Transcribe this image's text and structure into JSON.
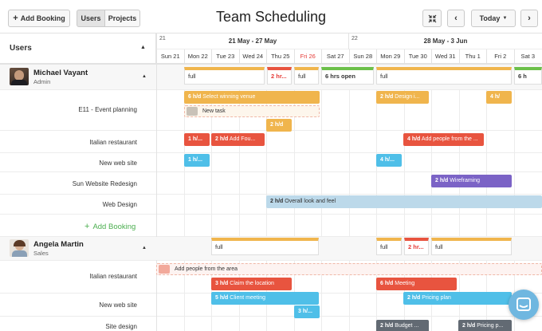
{
  "toolbar": {
    "add_booking_label": "Add Booking",
    "users_tab": "Users",
    "projects_tab": "Projects",
    "title": "Team Scheduling",
    "today_label": "Today"
  },
  "grid_header": {
    "users_label": "Users",
    "weeks": [
      {
        "num": "21",
        "range": "21 May - 27 May"
      },
      {
        "num": "22",
        "range": "28 May - 3 Jun"
      }
    ],
    "days": [
      "Sun 21",
      "Mon 22",
      "Tue 23",
      "Wed 24",
      "Thu 25",
      "Fri 26",
      "Sat 27",
      "Sun 28",
      "Mon 29",
      "Tue 30",
      "Wed 31",
      "Thu 1",
      "Fri 2",
      "Sat 3"
    ],
    "today_day_index": 5
  },
  "users": [
    {
      "name": "Michael Vayant",
      "role": "Admin",
      "summary": [
        {
          "text": "full"
        },
        {
          "text": "2 hr..."
        },
        {
          "text": "full"
        },
        {
          "text": "6 hrs open"
        },
        {
          "text": "full"
        },
        {
          "text": "6 h"
        }
      ],
      "projects": [
        {
          "name": "E11 - Event planning"
        },
        {
          "name": "Italian restaurant"
        },
        {
          "name": "New web site"
        },
        {
          "name": "Sun Website Redesign"
        },
        {
          "name": "Web Design"
        }
      ],
      "add_booking": "Add Booking",
      "bookings": [
        {
          "h": "6 h/d",
          "text": "Select winning venue"
        },
        {
          "h": "2 h/d",
          "text": "Design i..."
        },
        {
          "h": "4 h/",
          "text": ""
        },
        {
          "h": "",
          "text": "New task",
          "tentative": true
        },
        {
          "h": "2 h/d",
          "text": ""
        },
        {
          "h": "1 h/...",
          "text": ""
        },
        {
          "h": "2 h/d",
          "text": "Add Fou..."
        },
        {
          "h": "4 h/d",
          "text": "Add people from the ..."
        },
        {
          "h": "1 h/...",
          "text": ""
        },
        {
          "h": "4 h/...",
          "text": ""
        },
        {
          "h": "2 h/d",
          "text": "Wireframing"
        },
        {
          "h": "2 h/d",
          "text": "Overall look and feel"
        }
      ]
    },
    {
      "name": "Angela Martin",
      "role": "Sales",
      "summary": [
        {
          "text": "full"
        },
        {
          "text": "full"
        },
        {
          "text": "2 hr..."
        },
        {
          "text": "full"
        }
      ],
      "projects": [
        {
          "name": "Italian restaurant"
        },
        {
          "name": "New web site"
        },
        {
          "name": "Site design"
        }
      ],
      "bookings": [
        {
          "h": "",
          "text": "Add people from the area",
          "tentative": true
        },
        {
          "h": "3 h/d",
          "text": "Claim the location"
        },
        {
          "h": "6 h/d",
          "text": "Meeting"
        },
        {
          "h": "5 h/d",
          "text": "Client meeting"
        },
        {
          "h": "2 h/d",
          "text": "Pricing plan"
        },
        {
          "h": "3 h/...",
          "text": ""
        },
        {
          "h": "2 h/d",
          "text": "Budget ..."
        },
        {
          "h": "2 h/d",
          "text": "Pricing p..."
        }
      ]
    }
  ],
  "colors": {
    "orange": "#f0b54d",
    "red": "#e8543f",
    "blue": "#4fbfe8",
    "purple": "#7b63c6",
    "lightblue": "#bcd9ea",
    "green_bar": "#6cc04a",
    "gray": "#626a73",
    "today_red": "#e53935",
    "add_green": "#4caf50"
  },
  "icons": {
    "add": "plus-icon",
    "collapse": "collapse-icon",
    "prev": "chevron-left-icon",
    "next": "chevron-right-icon",
    "caret": "caret-down-icon",
    "chat": "chat-icon"
  }
}
